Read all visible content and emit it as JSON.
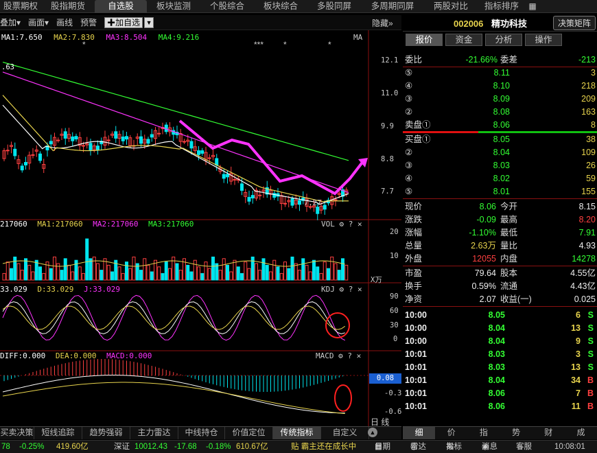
{
  "top_tabs": [
    {
      "label": "股票期权",
      "active": false
    },
    {
      "label": "股指期货",
      "active": false
    },
    {
      "label": "自选股",
      "active": true
    },
    {
      "label": "板块监测",
      "active": false
    },
    {
      "label": "个股综合",
      "active": false
    },
    {
      "label": "板块综合",
      "active": false
    },
    {
      "label": "多股同屏",
      "active": false
    },
    {
      "label": "多周期同屏",
      "active": false
    },
    {
      "label": "两股对比",
      "active": false
    },
    {
      "label": "指标排序",
      "active": false
    }
  ],
  "toolbar": {
    "add": "叠加▾",
    "draw": "画面▾",
    "line": "画线",
    "alert": "预警",
    "add_fav": "✚加自选",
    "dropdown": "▼",
    "hide": "隐藏»"
  },
  "ma_legend": {
    "ma1": "MA1:7.650",
    "ma2": "MA2:7.830",
    "ma3": "MA3:8.504",
    "ma4": "MA4:9.216",
    "right": "MA"
  },
  "price_axis": [
    "12.1",
    "11.0",
    "9.9",
    "8.8",
    "7.7"
  ],
  "price_left_label": ".63",
  "low_label": "7.27",
  "stars": [
    "*",
    "***",
    "*",
    "*"
  ],
  "vol_legend": {
    "v": "217060",
    "ma1": "MA1:217060",
    "ma2": "MA2:217060",
    "ma3": "MA3:217060",
    "name": "VOL"
  },
  "vol_axis": [
    "20",
    "10"
  ],
  "vol_unit": "X万",
  "kdj_legend": {
    "k": "33.029",
    "d": "D:33.029",
    "j": "J:33.029",
    "name": "KDJ"
  },
  "kdj_axis": [
    "90",
    "60",
    "30",
    "0"
  ],
  "macd_legend": {
    "diff": "DIFF:0.000",
    "dea": "DEA:0.000",
    "macd": "MACD:0.000",
    "name": "MACD"
  },
  "macd_axis": {
    "current": "0.08",
    "a": "-0.3",
    "b": "-0.6"
  },
  "period_label": "日 线",
  "stock": {
    "code": "002006",
    "name": "精功科技",
    "decision_btn": "决策矩阵"
  },
  "rp_tabs": [
    {
      "label": "报价",
      "active": true
    },
    {
      "label": "资金",
      "active": false
    },
    {
      "label": "分析",
      "active": false
    },
    {
      "label": "操作",
      "active": false
    }
  ],
  "weibi": {
    "label": "委比",
    "value": "-21.66%",
    "label2": "委差",
    "value2": "-213"
  },
  "asks": [
    {
      "label": "⑤",
      "price": "8.11",
      "vol": "3"
    },
    {
      "label": "④",
      "price": "8.10",
      "vol": "218"
    },
    {
      "label": "③",
      "price": "8.09",
      "vol": "209"
    },
    {
      "label": "②",
      "price": "8.08",
      "vol": "163"
    },
    {
      "label": "卖盘①",
      "price": "8.06",
      "vol": "8"
    }
  ],
  "bids": [
    {
      "label": "买盘①",
      "price": "8.05",
      "vol": "38"
    },
    {
      "label": "②",
      "price": "8.04",
      "vol": "109"
    },
    {
      "label": "③",
      "price": "8.03",
      "vol": "26"
    },
    {
      "label": "④",
      "price": "8.02",
      "vol": "59"
    },
    {
      "label": "⑤",
      "price": "8.01",
      "vol": "155"
    }
  ],
  "quote": [
    {
      "l1": "现价",
      "v1": "8.06",
      "c1": "grn",
      "l2": "今开",
      "v2": "8.15",
      "c2": "wht"
    },
    {
      "l1": "涨跌",
      "v1": "-0.09",
      "c1": "grn",
      "l2": "最高",
      "v2": "8.20",
      "c2": "red"
    },
    {
      "l1": "涨幅",
      "v1": "-1.10%",
      "c1": "grn",
      "l2": "最低",
      "v2": "7.91",
      "c2": "grn"
    },
    {
      "l1": "总量",
      "v1": "2.63万",
      "c1": "yel",
      "l2": "量比",
      "v2": "4.93",
      "c2": "wht"
    },
    {
      "l1": "外盘",
      "v1": "12055",
      "c1": "red",
      "l2": "内盘",
      "v2": "14278",
      "c2": "grn"
    }
  ],
  "fund": [
    {
      "l1": "市盈",
      "v1": "79.64",
      "l2": "股本",
      "v2": "4.55亿"
    },
    {
      "l1": "换手",
      "v1": "0.59%",
      "l2": "流通",
      "v2": "4.43亿"
    },
    {
      "l1": "净资",
      "v1": "2.07",
      "l2": "收益(一)",
      "v2": "0.025"
    }
  ],
  "ticks": [
    {
      "time": "10:00",
      "price": "8.05",
      "vol": "6",
      "side": "S"
    },
    {
      "time": "10:00",
      "price": "8.04",
      "vol": "13",
      "side": "S"
    },
    {
      "time": "10:00",
      "price": "8.04",
      "vol": "9",
      "side": "S"
    },
    {
      "time": "10:01",
      "price": "8.03",
      "vol": "3",
      "side": "S"
    },
    {
      "time": "10:01",
      "price": "8.03",
      "vol": "13",
      "side": "S"
    },
    {
      "time": "10:01",
      "price": "8.04",
      "vol": "34",
      "side": "B"
    },
    {
      "time": "10:01",
      "price": "8.06",
      "vol": "7",
      "side": "B"
    },
    {
      "time": "10:01",
      "price": "8.06",
      "vol": "11",
      "side": "B"
    }
  ],
  "bottom_tabs": [
    {
      "label": "买卖决策",
      "active": false
    },
    {
      "label": "短线追踪",
      "active": false
    },
    {
      "label": "趋势强弱",
      "active": false
    },
    {
      "label": "主力雷达",
      "active": false
    },
    {
      "label": "中线持仓",
      "active": false
    },
    {
      "label": "价值定位",
      "active": false
    },
    {
      "label": "传统指标",
      "active": true
    },
    {
      "label": "自定义",
      "active": false
    }
  ],
  "right_bottom_tabs": [
    {
      "label": "细",
      "active": true
    },
    {
      "label": "价",
      "active": false
    },
    {
      "label": "指",
      "active": false
    },
    {
      "label": "势",
      "active": false
    },
    {
      "label": "财",
      "active": false
    },
    {
      "label": "成",
      "active": false
    }
  ],
  "status": {
    "s1": "78",
    "s2": "-0.25%",
    "s3": "419.60亿",
    "sz_label": "深证",
    "sz_val": "10012.43",
    "sz_chg": "-17.68",
    "sz_pct": "-0.18%",
    "sz_amt": "610.67亿",
    "ticker": "贴 霸主还在成长中",
    "calendar": "日期",
    "radar": "雷达",
    "indicator": "指标",
    "news": "消息",
    "service": "客服",
    "time": "10:08:01"
  },
  "colors": {
    "red": "#ff4040",
    "green": "#33ff33",
    "cyan": "#00e5ee",
    "yellow": "#e8d44d",
    "magenta": "#ff00ff",
    "separator": "#8b1010"
  },
  "chart_data": [
    {
      "type": "candlestick",
      "title": "",
      "ylim": [
        7.2,
        12.6
      ],
      "ma_series": [
        {
          "name": "MA1"
        },
        {
          "name": "MA2"
        },
        {
          "name": "MA3"
        },
        {
          "name": "MA4"
        }
      ],
      "annotations": [
        "7.27"
      ]
    },
    {
      "type": "bar",
      "title": "VOL",
      "ylim": [
        0,
        22
      ],
      "unit": "万"
    },
    {
      "type": "line",
      "title": "KDJ",
      "ylim": [
        -10,
        100
      ],
      "series": [
        {
          "name": "K"
        },
        {
          "name": "D"
        },
        {
          "name": "J"
        }
      ]
    },
    {
      "type": "bar",
      "title": "MACD",
      "ylim": [
        -0.7,
        0.5
      ],
      "series": [
        {
          "name": "DIFF"
        },
        {
          "name": "DEA"
        },
        {
          "name": "MACD"
        }
      ]
    }
  ]
}
